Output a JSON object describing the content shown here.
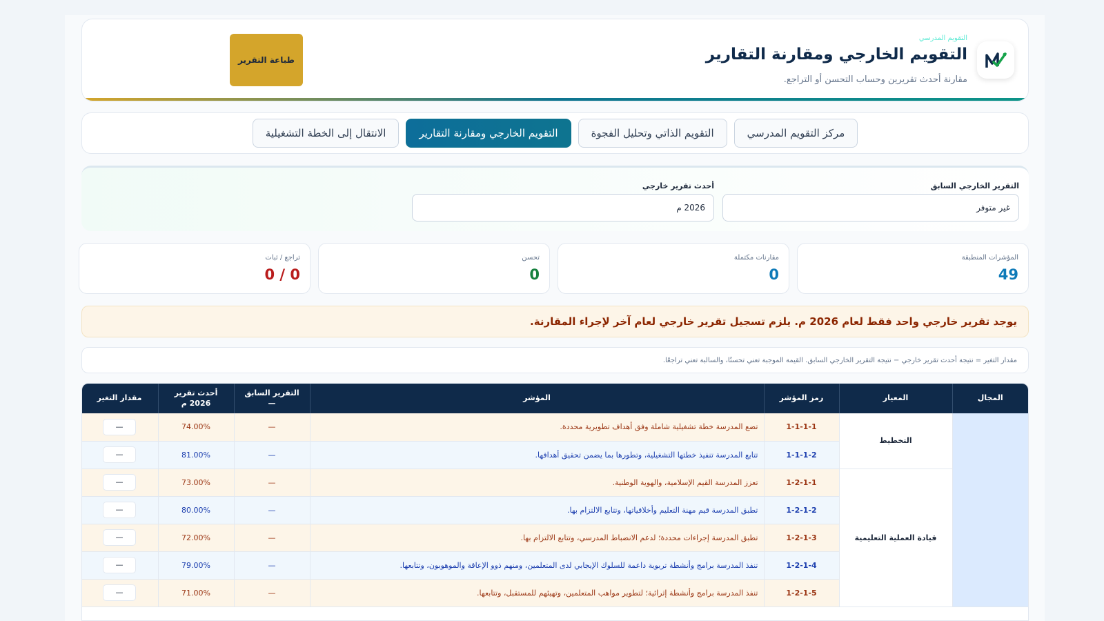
{
  "header": {
    "small_label": "التقويم المدرسي",
    "title": "التقويم الخارجي ومقارنة التقارير",
    "subtitle": "مقارنة أحدث تقريرين وحساب التحسن أو التراجع.",
    "print_label": "طباعة التقرير",
    "logo_icon": "chart-check-logo-icon"
  },
  "tabs": [
    {
      "label": "مركز التقويم المدرسي"
    },
    {
      "label": "التقويم الذاتي وتحليل الفجوة"
    },
    {
      "label": "التقويم الخارجي ومقارنة التقارير",
      "active": true
    },
    {
      "label": "الانتقال إلى الخطة التشغيلية"
    }
  ],
  "selects": {
    "previous_label": "التقرير الخارجي السابق",
    "previous_value": "غير متوفر",
    "latest_label": "أحدث تقرير خارجي",
    "latest_value": "2026 م"
  },
  "stats": [
    {
      "label": "المؤشرات المنطبقة",
      "value": "49",
      "color": "#0e7ab8"
    },
    {
      "label": "مقارنات مكتملة",
      "value": "0",
      "color": "#0e7ab8"
    },
    {
      "label": "تحسن",
      "value": "0",
      "color": "#15803d"
    },
    {
      "label": "تراجع / ثبات",
      "value": "0 / 0",
      "color": "#b91c1c"
    }
  ],
  "alert": "يوجد تقرير خارجي واحد فقط لعام 2026 م. يلزم تسجيل تقرير خارجي لعام آخر لإجراء المقارنة.",
  "note": "مقدار التغير = نتيجة أحدث تقرير خارجي − نتيجة التقرير الخارجي السابق. القيمة الموجبة تعني تحسنًا، والسالبة تعني تراجعًا.",
  "table": {
    "headers": {
      "domain": "المجال",
      "standard": "المعيار",
      "code": "رمز المؤشر",
      "indicator": "المؤشر",
      "previous": "التقرير السابق",
      "previous_sub": "—",
      "latest": "أحدث تقرير",
      "latest_sub": "2026 م",
      "change": "مقدار التغير"
    },
    "standards": [
      "التخطيط",
      "قيادة العملية التعليمية"
    ],
    "rows": [
      {
        "code": "1-1-1-1",
        "indicator": "تضع المدرسة خطة تشغيلية شاملة وفق أهداف تطويرية محددة.",
        "previous": "—",
        "latest": "74.00%",
        "change": "—"
      },
      {
        "code": "1-1-1-2",
        "indicator": "تتابع المدرسة تنفيذ خطتها التشغيلية، وتطورها بما يضمن تحقيق أهدافها.",
        "previous": "—",
        "latest": "81.00%",
        "change": "—"
      },
      {
        "code": "1-2-1-1",
        "indicator": "تعزز المدرسة القيم الإسلامية، والهوية الوطنية.",
        "previous": "—",
        "latest": "73.00%",
        "change": "—"
      },
      {
        "code": "1-2-1-2",
        "indicator": "تطبق المدرسة قيم مهنة التعليم وأخلاقياتها، وتتابع الالتزام بها.",
        "previous": "—",
        "latest": "80.00%",
        "change": "—"
      },
      {
        "code": "1-2-1-3",
        "indicator": "تطبق المدرسة إجراءات محددة؛ لدعم الانضباط المدرسي، وتتابع الالتزام بها.",
        "previous": "—",
        "latest": "72.00%",
        "change": "—"
      },
      {
        "code": "1-2-1-4",
        "indicator": "تنفذ المدرسة برامج وأنشطة تربوية داعمة للسلوك الإيجابي لدى المتعلمين، ومنهم ذوو الإعاقة والموهوبون، وتتابعها.",
        "previous": "—",
        "latest": "79.00%",
        "change": "—"
      },
      {
        "code": "1-2-1-5",
        "indicator": "تنفذ المدرسة برامج وأنشطة إثرائية؛ لتطوير مواهب المتعلمين، وتهيئهم للمستقبل، وتتابعها.",
        "previous": "—",
        "latest": "71.00%",
        "change": "—"
      }
    ]
  }
}
